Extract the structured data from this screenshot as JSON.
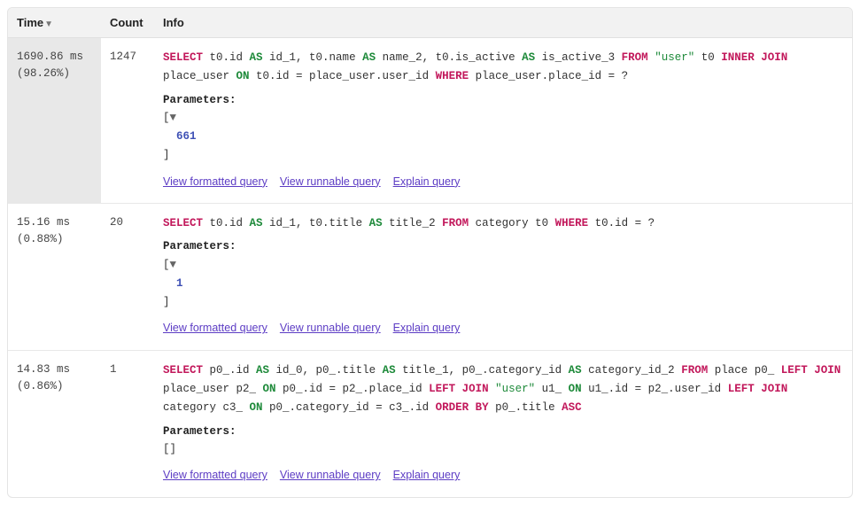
{
  "columns": {
    "time": "Time",
    "count": "Count",
    "info": "Info"
  },
  "labels": {
    "parameters": "Parameters",
    "view_formatted": "View formatted query",
    "view_runnable": "View runnable query",
    "explain": "Explain query"
  },
  "rows": [
    {
      "time_ms": "1690.86 ms",
      "time_pct": "(98.26%)",
      "count": "1247",
      "highlight": true,
      "sql_tokens": [
        [
          "kw",
          "SELECT"
        ],
        [
          "",
          " t0.id "
        ],
        [
          "kw2",
          "AS"
        ],
        [
          "",
          " id_1, t0.name "
        ],
        [
          "kw2",
          "AS"
        ],
        [
          "",
          " name_2, t0.is_active "
        ],
        [
          "kw2",
          "AS"
        ],
        [
          "",
          " is_active_3 "
        ],
        [
          "kw",
          "FROM"
        ],
        [
          "",
          " "
        ],
        [
          "str",
          "\"user\""
        ],
        [
          "",
          " t0 "
        ],
        [
          "kw",
          "INNER JOIN"
        ],
        [
          "",
          " place_user "
        ],
        [
          "kw2",
          "ON"
        ],
        [
          "",
          " t0.id = place_user.user_id "
        ],
        [
          "kw",
          "WHERE"
        ],
        [
          "",
          " place_user.place_id = ?"
        ]
      ],
      "params": [
        "661"
      ]
    },
    {
      "time_ms": "15.16 ms",
      "time_pct": "(0.88%)",
      "count": "20",
      "highlight": false,
      "sql_tokens": [
        [
          "kw",
          "SELECT"
        ],
        [
          "",
          " t0.id "
        ],
        [
          "kw2",
          "AS"
        ],
        [
          "",
          " id_1, t0.title "
        ],
        [
          "kw2",
          "AS"
        ],
        [
          "",
          " title_2 "
        ],
        [
          "kw",
          "FROM"
        ],
        [
          "",
          " category t0 "
        ],
        [
          "kw",
          "WHERE"
        ],
        [
          "",
          " t0.id = ?"
        ]
      ],
      "params": [
        "1"
      ]
    },
    {
      "time_ms": "14.83 ms",
      "time_pct": "(0.86%)",
      "count": "1",
      "highlight": false,
      "sql_tokens": [
        [
          "kw",
          "SELECT"
        ],
        [
          "",
          " p0_.id "
        ],
        [
          "kw2",
          "AS"
        ],
        [
          "",
          " id_0, p0_.title "
        ],
        [
          "kw2",
          "AS"
        ],
        [
          "",
          " title_1, p0_.category_id "
        ],
        [
          "kw2",
          "AS"
        ],
        [
          "",
          " category_id_2 "
        ],
        [
          "kw",
          "FROM"
        ],
        [
          "",
          " place p0_ "
        ],
        [
          "kw",
          "LEFT JOIN"
        ],
        [
          "",
          " place_user p2_ "
        ],
        [
          "kw2",
          "ON"
        ],
        [
          "",
          " p0_.id = p2_.place_id "
        ],
        [
          "kw",
          "LEFT JOIN"
        ],
        [
          "",
          " "
        ],
        [
          "str",
          "\"user\""
        ],
        [
          "",
          " u1_ "
        ],
        [
          "kw2",
          "ON"
        ],
        [
          "",
          " u1_.id = p2_.user_id "
        ],
        [
          "kw",
          "LEFT JOIN"
        ],
        [
          "",
          " category c3_ "
        ],
        [
          "kw2",
          "ON"
        ],
        [
          "",
          " p0_.category_id = c3_.id "
        ],
        [
          "kw",
          "ORDER BY"
        ],
        [
          "",
          " p0_.title "
        ],
        [
          "kw",
          "ASC"
        ]
      ],
      "params": []
    }
  ]
}
